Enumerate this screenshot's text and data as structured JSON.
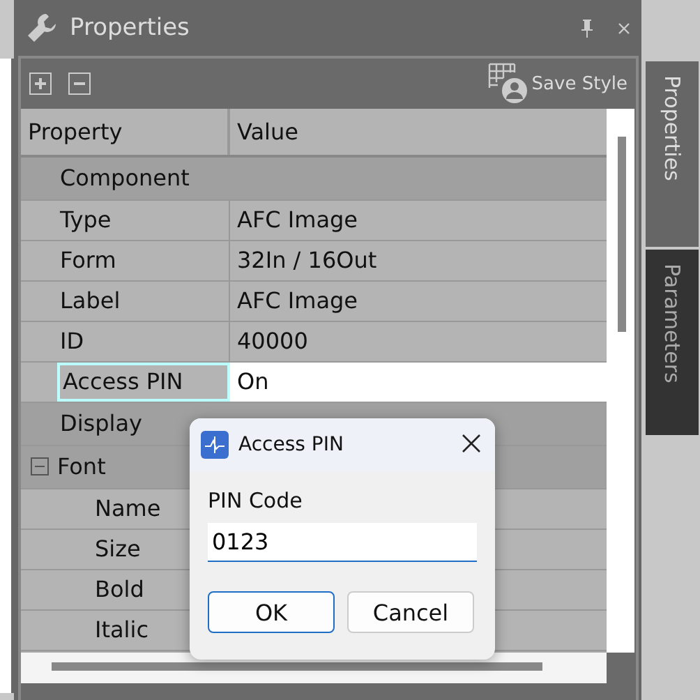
{
  "window": {
    "title": "Properties"
  },
  "toolbar": {
    "save_style": "Save Style"
  },
  "grid": {
    "columns": [
      "Property",
      "Value"
    ],
    "rows": [
      {
        "kind": "category",
        "label": "Component"
      },
      {
        "kind": "property",
        "label": "Type",
        "value": "AFC Image",
        "selected": false
      },
      {
        "kind": "property",
        "label": "Form",
        "value": "32In / 16Out",
        "selected": false
      },
      {
        "kind": "property",
        "label": "Label",
        "value": "AFC Image",
        "selected": false
      },
      {
        "kind": "property",
        "label": "ID",
        "value": "40000",
        "selected": false
      },
      {
        "kind": "property",
        "label": "Access PIN",
        "value": "On",
        "selected": true
      },
      {
        "kind": "category",
        "label": "Display"
      },
      {
        "kind": "group",
        "label": "Font",
        "expanded": true,
        "children": [
          {
            "kind": "property",
            "label": "Name",
            "selected": false
          },
          {
            "kind": "property",
            "label": "Size",
            "selected": false
          },
          {
            "kind": "property",
            "label": "Bold",
            "selected": false
          },
          {
            "kind": "property",
            "label": "Italic",
            "selected": false
          }
        ]
      }
    ]
  },
  "side_tabs": [
    {
      "label": "Properties",
      "selected": true
    },
    {
      "label": "Parameters",
      "selected": false
    }
  ],
  "dialog": {
    "title": "Access PIN",
    "field_label": "PIN Code",
    "value": "0123",
    "buttons": [
      {
        "label": "OK",
        "kind": "default"
      },
      {
        "label": "Cancel",
        "kind": "normal"
      }
    ]
  }
}
